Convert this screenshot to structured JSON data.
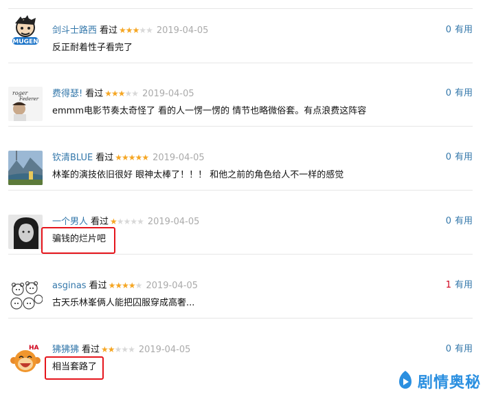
{
  "comments": [
    {
      "user": "剑斗士路西",
      "watched": "看过",
      "rating": 3,
      "date": "2019-04-05",
      "text": "反正耐着性子看完了",
      "votes": "0",
      "vote_label": "有用"
    },
    {
      "user": "费得瑟!",
      "watched": "看过",
      "rating": 3,
      "date": "2019-04-05",
      "text": "emmm电影节奏太奇怪了 看的人一愣一愣的 情节也略微俗套。有点浪费这阵容",
      "votes": "0",
      "vote_label": "有用"
    },
    {
      "user": "钦清BLUE",
      "watched": "看过",
      "rating": 5,
      "date": "2019-04-05",
      "text": "林峯的演技依旧很好 眼神太棒了！！！ 和他之前的角色给人不一样的感觉",
      "votes": "0",
      "vote_label": "有用"
    },
    {
      "user": "一个男人",
      "watched": "看过",
      "rating": 1,
      "date": "2019-04-05",
      "text": "骗钱的烂片吧",
      "votes": "0",
      "vote_label": "有用"
    },
    {
      "user": "asginas",
      "watched": "看过",
      "rating": 4,
      "date": "2019-04-05",
      "text": "古天乐林峯俩人能把囚服穿成高奢...",
      "votes": "1",
      "vote_label": "有用"
    },
    {
      "user": "狒狒狒",
      "watched": "看过",
      "rating": 2,
      "date": "2019-04-05",
      "text": "相当套路了",
      "votes": "0",
      "vote_label": "有用"
    }
  ],
  "watermark": "剧情奥秘",
  "colors": {
    "link": "#3377aa",
    "star": "#f5a623",
    "highlight": "#e5141b",
    "vote_positive": "#d0021b"
  },
  "icons": [
    "avatar-cartoon-mugen",
    "avatar-federer",
    "avatar-mountain-lake",
    "avatar-portrait-bw",
    "avatar-bears-sketch",
    "avatar-laughing-monkey",
    "stars-rating",
    "watermark-play-icon"
  ]
}
